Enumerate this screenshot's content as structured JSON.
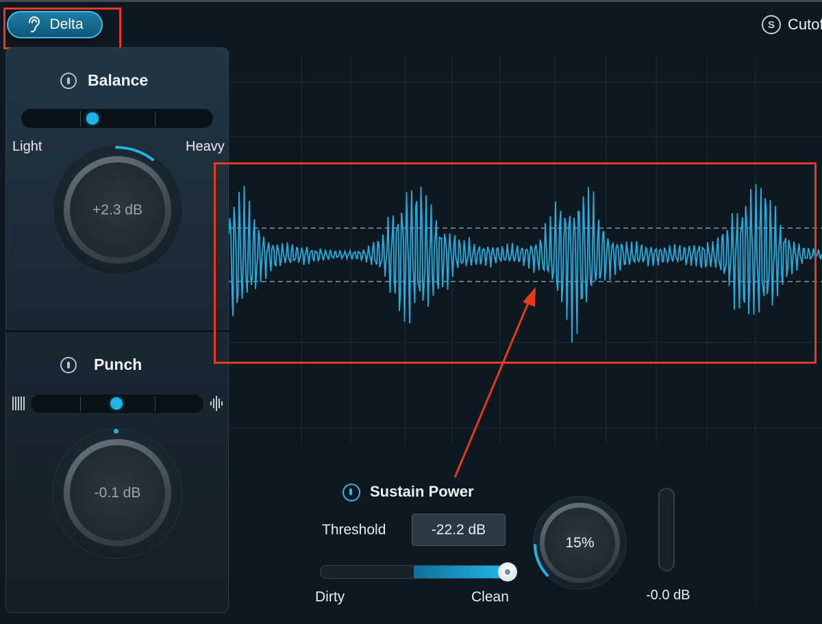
{
  "toolbar": {
    "delta_label": "Delta",
    "cutoff_label": "Cutoff",
    "cutoff_icon_text": "S"
  },
  "balance": {
    "title": "Balance",
    "left_label": "Light",
    "right_label": "Heavy",
    "knob_value": "+2.3 dB"
  },
  "punch": {
    "title": "Punch",
    "knob_value": "-0.1 dB"
  },
  "sustain": {
    "title": "Sustain Power",
    "threshold_label": "Threshold",
    "threshold_value": "-22.2 dB",
    "left_label": "Dirty",
    "right_label": "Clean",
    "mix_value": "15%",
    "meter_value": "-0.0 dB"
  },
  "colors": {
    "accent": "#1fb4e6",
    "highlight": "#e53a1f",
    "background": "#0e1820"
  }
}
